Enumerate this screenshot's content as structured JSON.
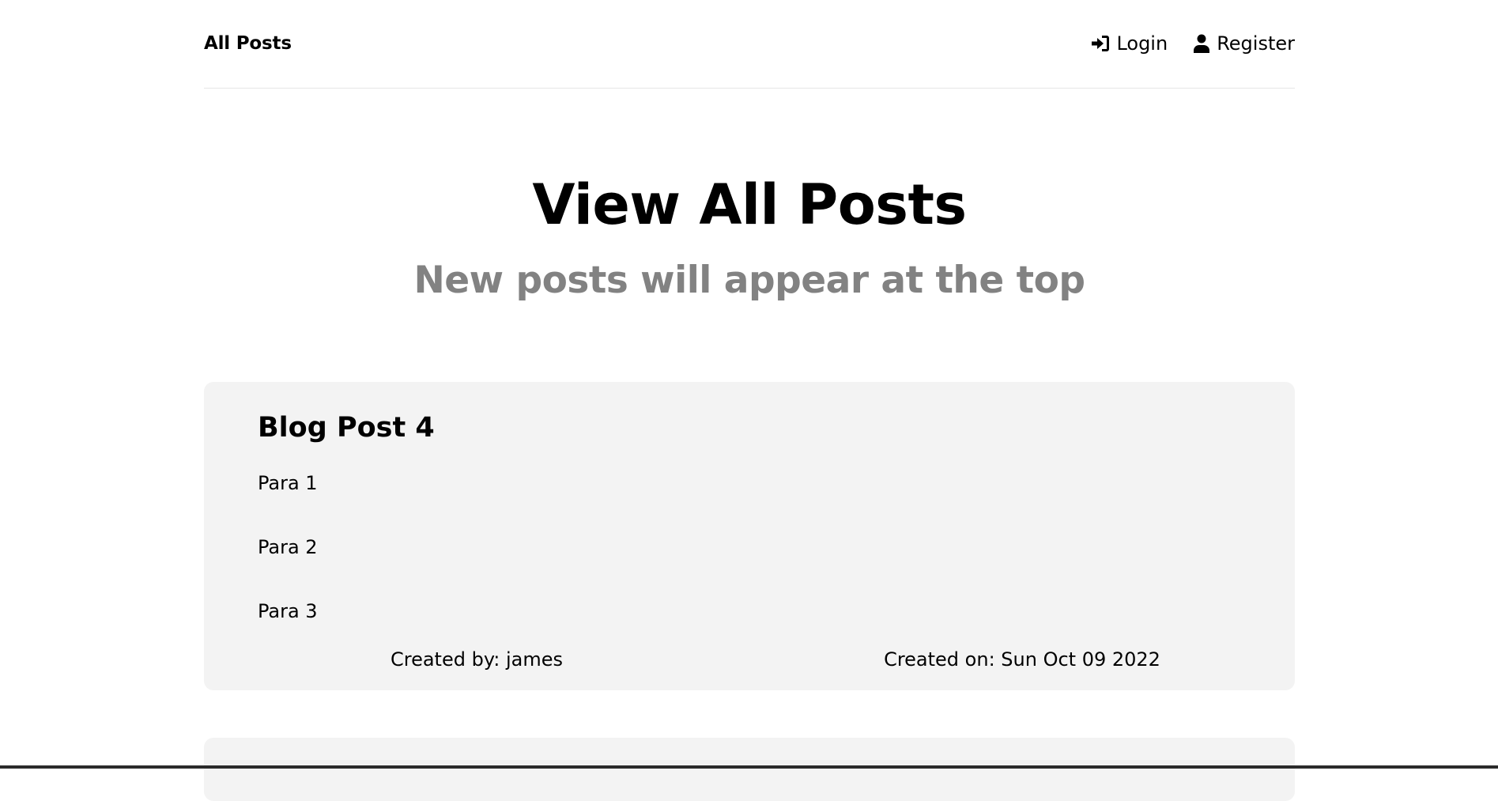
{
  "navbar": {
    "brand": "All Posts",
    "login_label": "Login",
    "register_label": "Register"
  },
  "header": {
    "title": "View All Posts",
    "subtitle": "New posts will appear at the top"
  },
  "posts": [
    {
      "title": "Blog Post 4",
      "paragraphs": [
        "Para 1",
        "Para 2",
        "Para 3"
      ],
      "created_by": "Created by: james",
      "created_on": "Created on: Sun Oct 09 2022"
    }
  ],
  "icons": {
    "login": "sign-in-icon",
    "register": "user-icon"
  },
  "colors": {
    "card_background": "#f3f3f3",
    "subtitle": "#828282",
    "divider": "#e6e6e6"
  }
}
